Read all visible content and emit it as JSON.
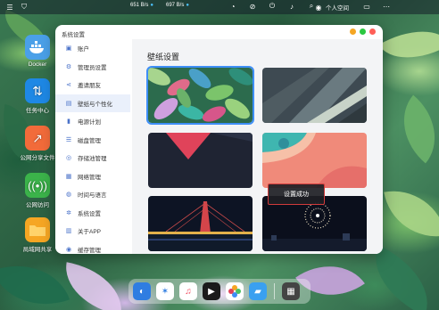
{
  "topbar": {
    "net_up": "651 B/s",
    "net_down": "697 B/s",
    "user_name": "个人空间"
  },
  "desktop": {
    "icons": [
      {
        "label": "Docker"
      },
      {
        "label": "任务中心"
      },
      {
        "label": "公网分享文件"
      },
      {
        "label": "公网访问"
      },
      {
        "label": "局域网共享"
      }
    ]
  },
  "window": {
    "title": "系统设置",
    "sidebar": [
      {
        "label": "账户",
        "icon": "user-icon"
      },
      {
        "label": "管理员设置",
        "icon": "admin-icon"
      },
      {
        "label": "邀请朋友",
        "icon": "share-icon"
      },
      {
        "label": "壁纸与个性化",
        "icon": "wallpaper-icon"
      },
      {
        "label": "电源计划",
        "icon": "power-icon"
      },
      {
        "label": "磁盘管理",
        "icon": "disk-icon"
      },
      {
        "label": "存储池管理",
        "icon": "storage-icon"
      },
      {
        "label": "网络管理",
        "icon": "network-icon"
      },
      {
        "label": "时间与语言",
        "icon": "globe-icon"
      },
      {
        "label": "系统设置",
        "icon": "gear-icon"
      },
      {
        "label": "关于APP",
        "icon": "info-icon"
      },
      {
        "label": "缓存管理",
        "icon": "cache-icon"
      }
    ],
    "active_item": "壁纸与个性化",
    "content_title": "壁纸设置",
    "toast": "设置成功"
  },
  "dock": {
    "apps": [
      "finder-icon",
      "compass-icon",
      "music-icon",
      "video-icon",
      "photos-icon",
      "folder-icon",
      "gallery-icon"
    ]
  },
  "colors": {
    "accent": "#3e8ef7",
    "toast_border": "#d23b3b"
  }
}
